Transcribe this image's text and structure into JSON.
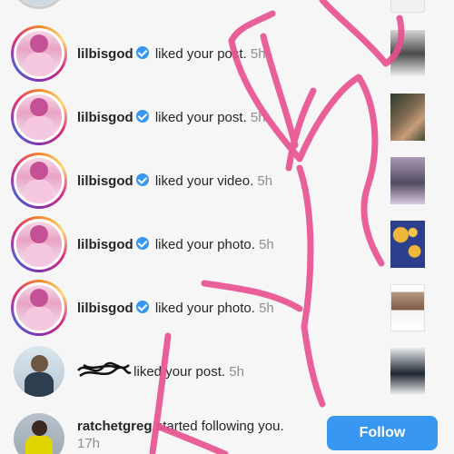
{
  "notifications": [
    {
      "username": "lilbisgod",
      "verified": true,
      "action": "liked your post.",
      "time": "5h",
      "avatar": "pink-hair-avatar",
      "thumbnail": "group-photo-thumbnail"
    },
    {
      "username": "lilbisgod",
      "verified": true,
      "action": "liked your post.",
      "time": "5h",
      "avatar": "pink-hair-avatar",
      "thumbnail": "camo-photo-thumbnail"
    },
    {
      "username": "lilbisgod",
      "verified": true,
      "action": "liked your video.",
      "time": "5h",
      "avatar": "pink-hair-avatar",
      "thumbnail": "purple-photo-thumbnail"
    },
    {
      "username": "lilbisgod",
      "verified": true,
      "action": "liked your photo.",
      "time": "5h",
      "avatar": "pink-hair-avatar",
      "thumbnail": "sun-moon-pattern-thumbnail"
    },
    {
      "username": "lilbisgod",
      "verified": true,
      "action": "liked your photo.",
      "time": "5h",
      "avatar": "pink-hair-avatar",
      "thumbnail": "screenshot-thumbnail"
    },
    {
      "username": "",
      "verified": false,
      "action": "liked your post.",
      "time": "5h",
      "avatar": "redacted-user-avatar",
      "thumbnail": "group-photo-thumbnail-2"
    },
    {
      "username": "ratchetgreg",
      "verified": false,
      "action": "started following you.",
      "time": "17h",
      "avatar": "yellow-jacket-avatar",
      "thumbnail": ""
    }
  ],
  "follow_button": {
    "label": "Follow"
  },
  "colors": {
    "accent": "#3897f0",
    "scribble": "#e8508f",
    "timestamp": "#8e8e8e"
  }
}
